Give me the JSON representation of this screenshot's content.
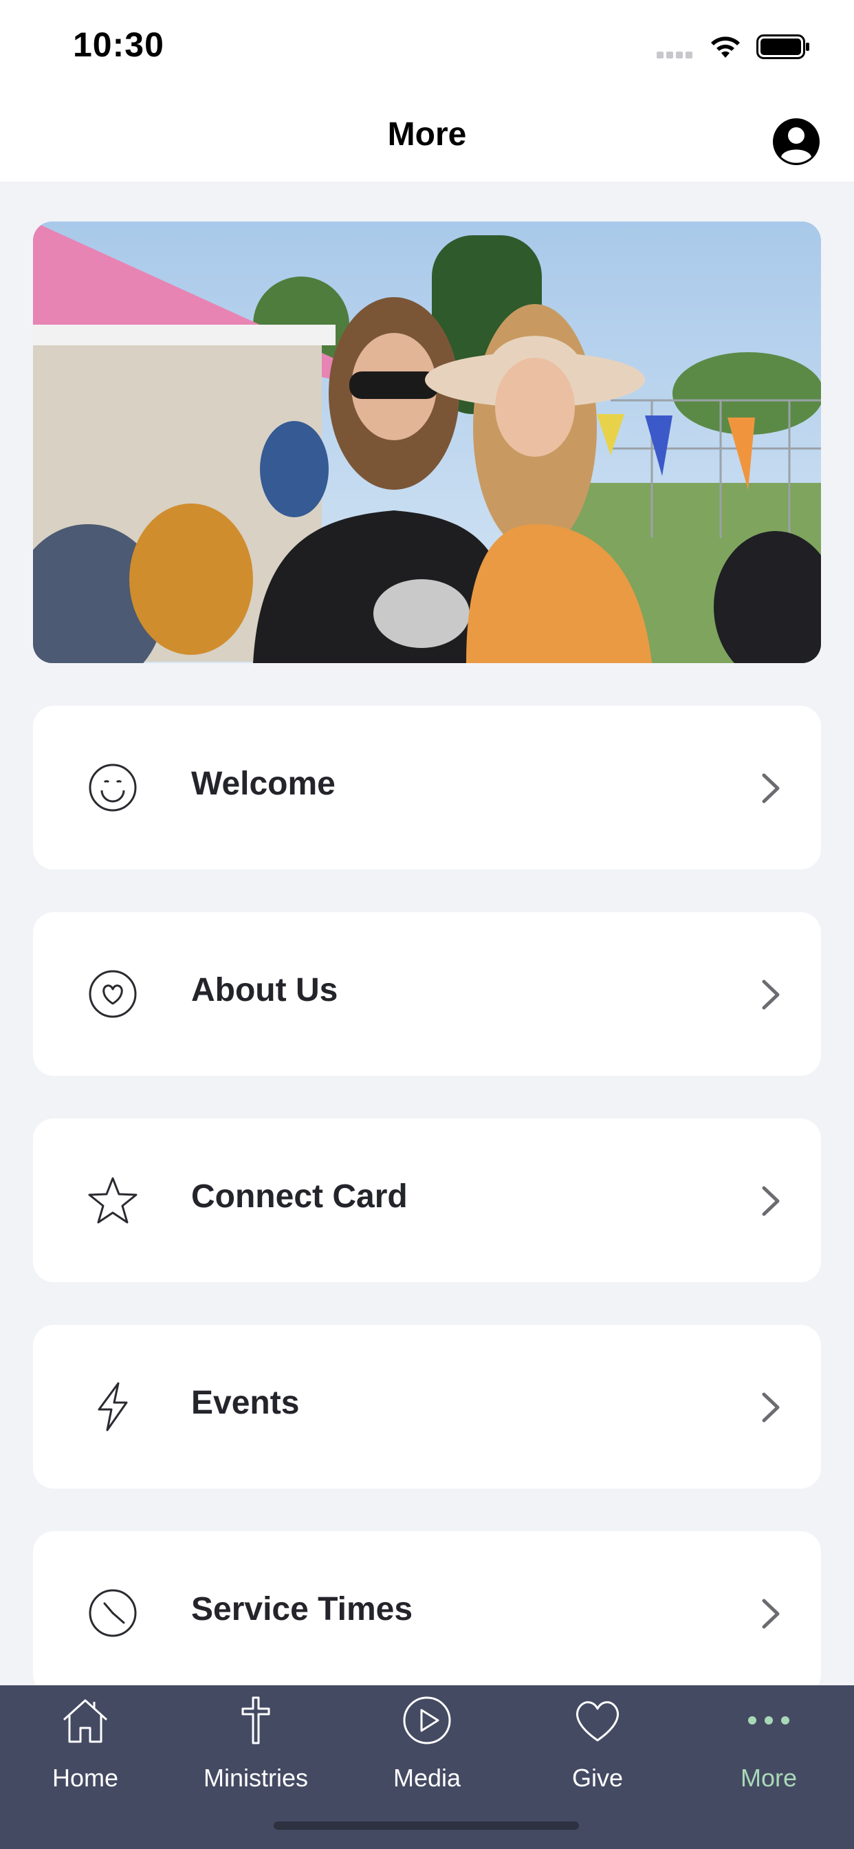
{
  "status_bar": {
    "time": "10:30"
  },
  "nav": {
    "title": "More"
  },
  "menu": [
    {
      "label": "Welcome",
      "icon": "smiley-icon"
    },
    {
      "label": "About Us",
      "icon": "heart-circle-icon"
    },
    {
      "label": "Connect Card",
      "icon": "star-icon"
    },
    {
      "label": "Events",
      "icon": "lightning-icon"
    },
    {
      "label": "Service Times",
      "icon": "clock-icon"
    }
  ],
  "tabs": [
    {
      "label": "Home",
      "icon": "home-icon"
    },
    {
      "label": "Ministries",
      "icon": "cross-icon"
    },
    {
      "label": "Media",
      "icon": "play-circle-icon"
    },
    {
      "label": "Give",
      "icon": "heart-icon"
    },
    {
      "label": "More",
      "icon": "more-dots-icon",
      "active": true
    }
  ],
  "colors": {
    "tab_bar_bg": "#454a63",
    "active_tab": "#a8d9b7",
    "page_bg": "#f2f3f7"
  }
}
